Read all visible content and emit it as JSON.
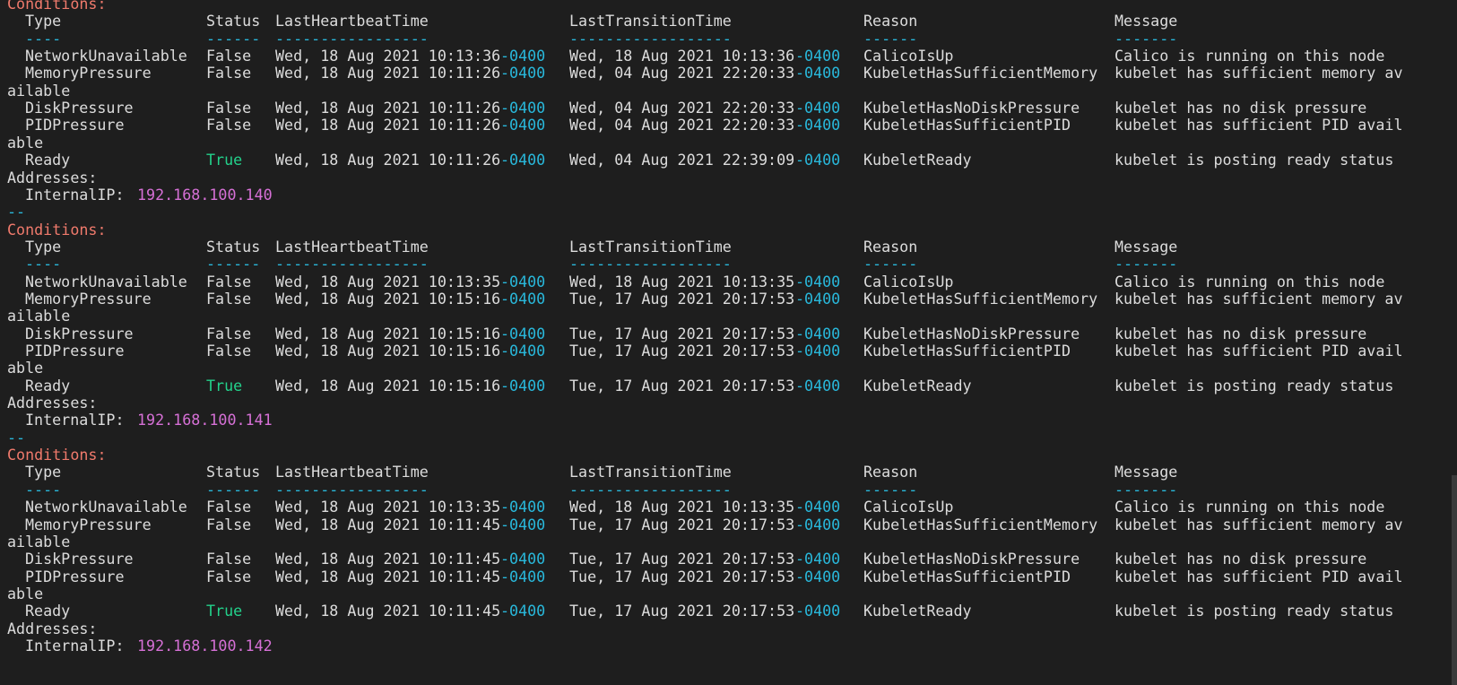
{
  "terminal": {
    "columns": {
      "type": "Type",
      "status": "Status",
      "last_heartbeat": "LastHeartbeatTime",
      "last_transition": "LastTransitionTime",
      "reason": "Reason",
      "message": "Message"
    },
    "underlines": {
      "type": "----",
      "status": "------",
      "last_heartbeat": "-----------------",
      "last_transition": "------------------",
      "reason": "------",
      "message": "-------"
    },
    "conditions_label": "Conditions:",
    "addresses_label": "Addresses:",
    "internal_ip_label": "InternalIP:",
    "separator": "--",
    "tz": "-0400",
    "blocks": [
      {
        "rows": [
          {
            "type": "NetworkUnavailable",
            "status": "False",
            "hb": "Wed, 18 Aug 2021 10:13:36",
            "tr": "Wed, 18 Aug 2021 10:13:36",
            "reason": "CalicoIsUp",
            "message": "Calico is running on this node",
            "wrap": ""
          },
          {
            "type": "MemoryPressure",
            "status": "False",
            "hb": "Wed, 18 Aug 2021 10:11:26",
            "tr": "Wed, 04 Aug 2021 22:20:33",
            "reason": "KubeletHasSufficientMemory",
            "message": "kubelet has sufficient memory av",
            "wrap": "ailable"
          },
          {
            "type": "DiskPressure",
            "status": "False",
            "hb": "Wed, 18 Aug 2021 10:11:26",
            "tr": "Wed, 04 Aug 2021 22:20:33",
            "reason": "KubeletHasNoDiskPressure",
            "message": "kubelet has no disk pressure",
            "wrap": ""
          },
          {
            "type": "PIDPressure",
            "status": "False",
            "hb": "Wed, 18 Aug 2021 10:11:26",
            "tr": "Wed, 04 Aug 2021 22:20:33",
            "reason": "KubeletHasSufficientPID",
            "message": "kubelet has sufficient PID avail",
            "wrap": "able"
          },
          {
            "type": "Ready",
            "status": "True",
            "hb": "Wed, 18 Aug 2021 10:11:26",
            "tr": "Wed, 04 Aug 2021 22:39:09",
            "reason": "KubeletReady",
            "message": "kubelet is posting ready status",
            "wrap": ""
          }
        ],
        "internal_ip": "192.168.100.140"
      },
      {
        "rows": [
          {
            "type": "NetworkUnavailable",
            "status": "False",
            "hb": "Wed, 18 Aug 2021 10:13:35",
            "tr": "Wed, 18 Aug 2021 10:13:35",
            "reason": "CalicoIsUp",
            "message": "Calico is running on this node",
            "wrap": ""
          },
          {
            "type": "MemoryPressure",
            "status": "False",
            "hb": "Wed, 18 Aug 2021 10:15:16",
            "tr": "Tue, 17 Aug 2021 20:17:53",
            "reason": "KubeletHasSufficientMemory",
            "message": "kubelet has sufficient memory av",
            "wrap": "ailable"
          },
          {
            "type": "DiskPressure",
            "status": "False",
            "hb": "Wed, 18 Aug 2021 10:15:16",
            "tr": "Tue, 17 Aug 2021 20:17:53",
            "reason": "KubeletHasNoDiskPressure",
            "message": "kubelet has no disk pressure",
            "wrap": ""
          },
          {
            "type": "PIDPressure",
            "status": "False",
            "hb": "Wed, 18 Aug 2021 10:15:16",
            "tr": "Tue, 17 Aug 2021 20:17:53",
            "reason": "KubeletHasSufficientPID",
            "message": "kubelet has sufficient PID avail",
            "wrap": "able"
          },
          {
            "type": "Ready",
            "status": "True",
            "hb": "Wed, 18 Aug 2021 10:15:16",
            "tr": "Tue, 17 Aug 2021 20:17:53",
            "reason": "KubeletReady",
            "message": "kubelet is posting ready status",
            "wrap": ""
          }
        ],
        "internal_ip": "192.168.100.141"
      },
      {
        "rows": [
          {
            "type": "NetworkUnavailable",
            "status": "False",
            "hb": "Wed, 18 Aug 2021 10:13:35",
            "tr": "Wed, 18 Aug 2021 10:13:35",
            "reason": "CalicoIsUp",
            "message": "Calico is running on this node",
            "wrap": ""
          },
          {
            "type": "MemoryPressure",
            "status": "False",
            "hb": "Wed, 18 Aug 2021 10:11:45",
            "tr": "Tue, 17 Aug 2021 20:17:53",
            "reason": "KubeletHasSufficientMemory",
            "message": "kubelet has sufficient memory av",
            "wrap": "ailable"
          },
          {
            "type": "DiskPressure",
            "status": "False",
            "hb": "Wed, 18 Aug 2021 10:11:45",
            "tr": "Tue, 17 Aug 2021 20:17:53",
            "reason": "KubeletHasNoDiskPressure",
            "message": "kubelet has no disk pressure",
            "wrap": ""
          },
          {
            "type": "PIDPressure",
            "status": "False",
            "hb": "Wed, 18 Aug 2021 10:11:45",
            "tr": "Tue, 17 Aug 2021 20:17:53",
            "reason": "KubeletHasSufficientPID",
            "message": "kubelet has sufficient PID avail",
            "wrap": "able"
          },
          {
            "type": "Ready",
            "status": "True",
            "hb": "Wed, 18 Aug 2021 10:11:45",
            "tr": "Tue, 17 Aug 2021 20:17:53",
            "reason": "KubeletReady",
            "message": "kubelet is posting ready status",
            "wrap": ""
          }
        ],
        "internal_ip": "192.168.100.142"
      }
    ]
  },
  "colors": {
    "background": "#1e1e1e",
    "text": "#dcdcdc",
    "label_red": "#f07a6c",
    "tz_cyan": "#29b8db",
    "true_green": "#23d18b",
    "ip_magenta": "#d670d6"
  }
}
